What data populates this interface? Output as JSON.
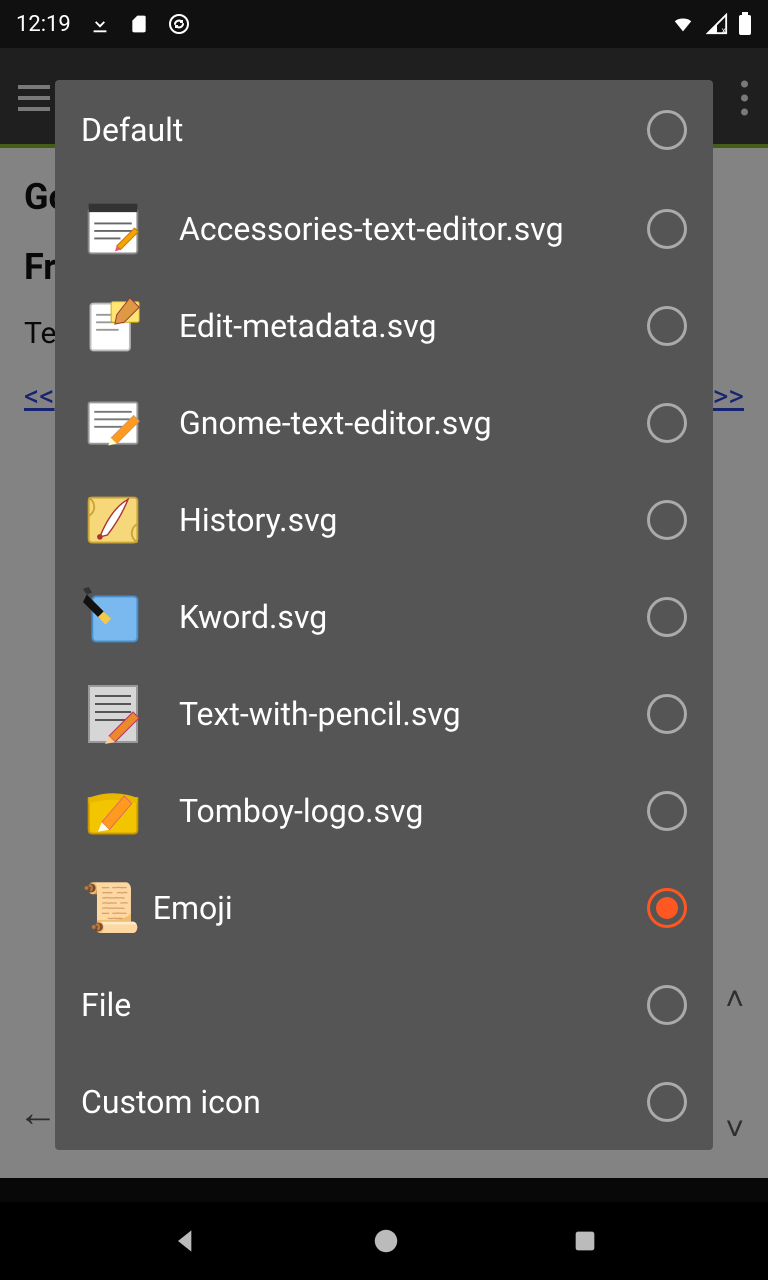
{
  "statusbar": {
    "time": "12:19"
  },
  "page": {
    "heading1": "Go",
    "heading2": "Fr",
    "text1": "Te",
    "prev": "<<",
    "next": ">>"
  },
  "dialog": {
    "default_label": "Default",
    "items": [
      {
        "label": "Accessories-text-editor.svg",
        "icon": "notepad",
        "selected": false
      },
      {
        "label": "Edit-metadata.svg",
        "icon": "metadata",
        "selected": false
      },
      {
        "label": "Gnome-text-editor.svg",
        "icon": "gnome-notepad",
        "selected": false
      },
      {
        "label": "History.svg",
        "icon": "scroll-quill",
        "selected": false
      },
      {
        "label": "Kword.svg",
        "icon": "kword",
        "selected": false
      },
      {
        "label": "Text-with-pencil.svg",
        "icon": "text-pencil",
        "selected": false
      },
      {
        "label": "Tomboy-logo.svg",
        "icon": "tomboy",
        "selected": false
      }
    ],
    "emoji_item": {
      "emoji": "📜",
      "label": "Emoji",
      "selected": true
    },
    "file_label": "File",
    "custom_label": "Custom icon"
  }
}
